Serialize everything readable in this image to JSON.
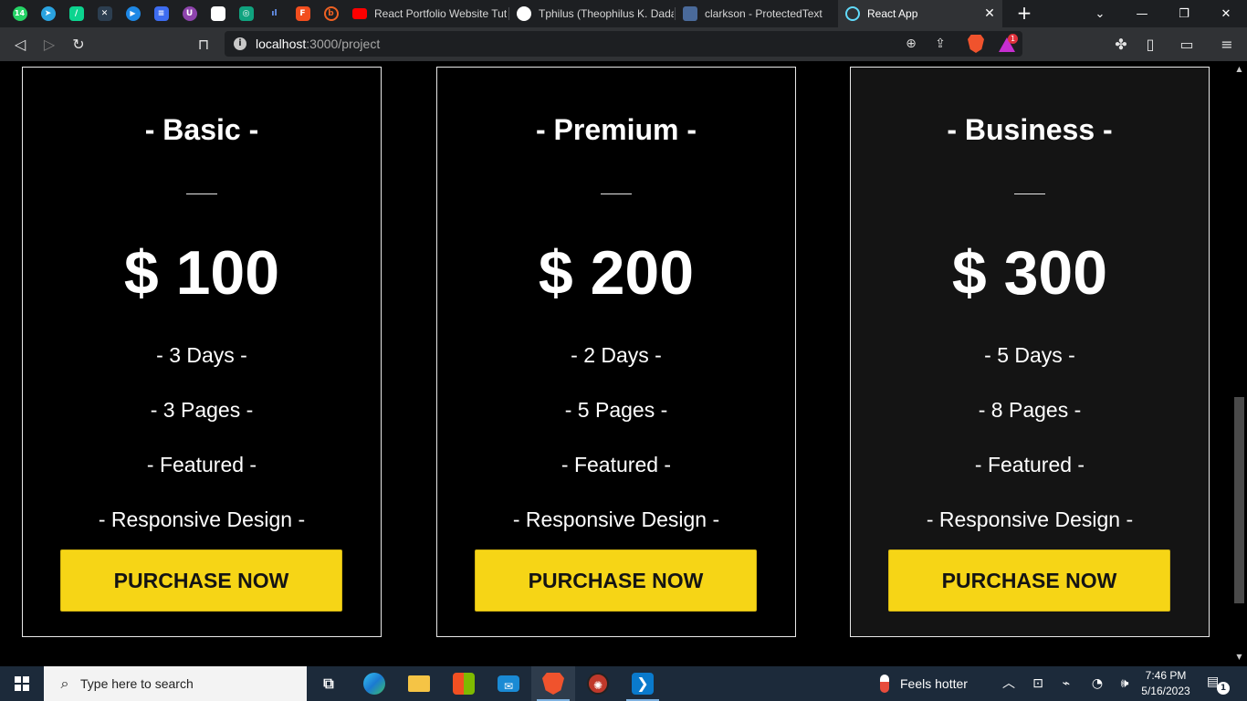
{
  "browser": {
    "pinned_tabs": [
      {
        "icon": "whatsapp-icon",
        "color": "#25d366",
        "glyph": "14"
      },
      {
        "icon": "telegram-icon",
        "color": "#2aa3e0",
        "glyph": "➤"
      },
      {
        "icon": "app-icon",
        "color": "#0cd48f",
        "glyph": "/"
      },
      {
        "icon": "tool-icon",
        "color": "#2c3e50",
        "glyph": "✕"
      },
      {
        "icon": "play-icon",
        "color": "#1e88e5",
        "glyph": "▶"
      },
      {
        "icon": "docs-icon",
        "color": "#3d6cf0",
        "glyph": "≡"
      },
      {
        "icon": "shield-icon",
        "color": "#8e44ad",
        "glyph": "U"
      },
      {
        "icon": "notion-icon",
        "color": "#ffffff",
        "glyph": ""
      },
      {
        "icon": "chatgpt-icon",
        "color": "#10a37f",
        "glyph": "◎"
      },
      {
        "icon": "chart-icon",
        "color": "#2b5bd7",
        "glyph": "ıl"
      },
      {
        "icon": "figma-icon",
        "color": "#f24e1e",
        "glyph": "F"
      },
      {
        "icon": "bitly-icon",
        "color": "#ee6123",
        "glyph": "b"
      }
    ],
    "tabs": [
      {
        "title": "React Portfolio Website Tut",
        "favicon": "youtube-icon",
        "color": "#ff0000",
        "active": false
      },
      {
        "title": "Tphilus (Theophilus K. Dada",
        "favicon": "github-icon",
        "color": "#ffffff",
        "active": false
      },
      {
        "title": "clarkson - ProtectedText",
        "favicon": "protectedtext-icon",
        "color": "#4a6a9a",
        "active": false
      },
      {
        "title": "React App",
        "favicon": "react-icon",
        "color": "#61dafb",
        "active": true
      }
    ],
    "url": {
      "host": "localhost",
      "path": ":3000/project"
    },
    "rewards_badge": "1"
  },
  "plans": [
    {
      "name": "- Basic -",
      "price": "$ 100",
      "features": [
        "- 3 Days -",
        "- 3 Pages -",
        "- Featured -",
        "- Responsive Design -"
      ],
      "button": "PURCHASE NOW"
    },
    {
      "name": "- Premium -",
      "price": "$ 200",
      "features": [
        "- 2 Days -",
        "- 5 Pages -",
        "- Featured -",
        "- Responsive Design -"
      ],
      "button": "PURCHASE NOW"
    },
    {
      "name": "- Business -",
      "price": "$ 300",
      "features": [
        "- 5 Days -",
        "- 8 Pages -",
        "- Featured -",
        "- Responsive Design -"
      ],
      "button": "PURCHASE NOW"
    }
  ],
  "colors": {
    "accent": "#f6d516",
    "page_bg": "#000000",
    "highlight_card": "#141414"
  },
  "taskbar": {
    "search_placeholder": "Type here to search",
    "weather": "Feels hotter",
    "time": "7:46 PM",
    "date": "5/16/2023",
    "notification_count": "1"
  }
}
